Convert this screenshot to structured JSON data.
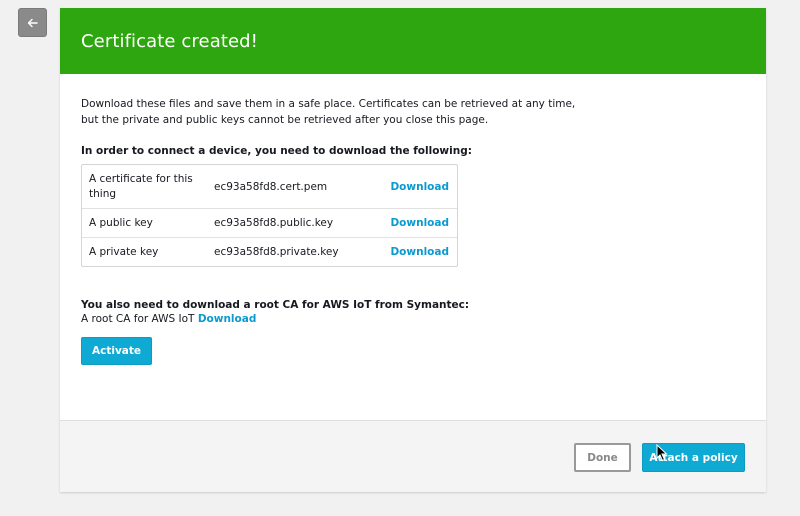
{
  "banner": {
    "title": "Certificate created!",
    "color": "#2ea60f"
  },
  "intro": "Download these files and save them in a safe place. Certificates can be retrieved at any time, but the private and public keys cannot be retrieved after you close this page.",
  "files": {
    "heading": "In order to connect a device, you need to download the following:",
    "rows": [
      {
        "label": "A certificate for this thing",
        "file": "ec93a58fd8.cert.pem",
        "action": "Download"
      },
      {
        "label": "A public key",
        "file": "ec93a58fd8.public.key",
        "action": "Download"
      },
      {
        "label": "A private key",
        "file": "ec93a58fd8.private.key",
        "action": "Download"
      }
    ]
  },
  "root_ca": {
    "heading": "You also need to download a root CA for AWS IoT from Symantec:",
    "label": "A root CA for AWS IoT",
    "action": "Download"
  },
  "buttons": {
    "activate": "Activate",
    "done": "Done",
    "attach": "Attach a policy"
  },
  "icons": {
    "back": "arrow-left-icon",
    "cursor": "mouse-pointer-icon"
  },
  "colors": {
    "primary": "#0eaad3",
    "link": "#0a9ad0"
  }
}
